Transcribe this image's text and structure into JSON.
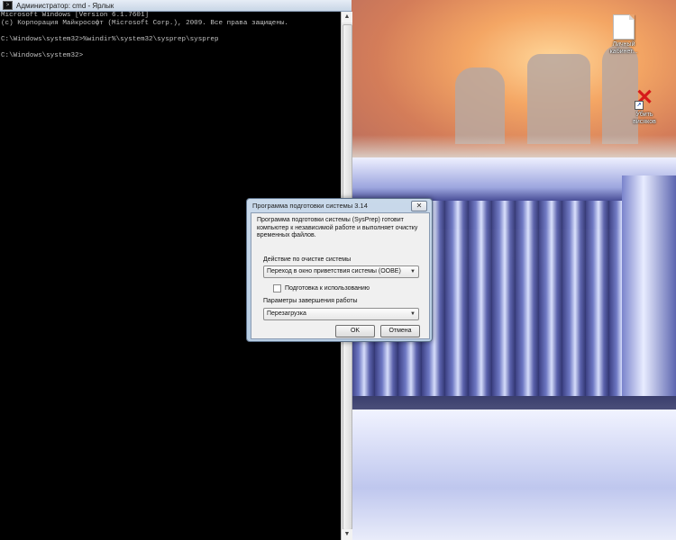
{
  "cmd": {
    "title": "Администратор: cmd - Ярлык",
    "lines": [
      "Microsoft Windows [Version 6.1.7601]",
      "(c) Корпорация Майкрософт (Microsoft Corp.), 2009. Все права защищены.",
      "",
      "C:\\Windows\\system32>%windir%\\system32\\sysprep\\sysprep",
      "",
      "C:\\Windows\\system32>"
    ]
  },
  "desktop": {
    "icons": [
      {
        "label_1": "Личный",
        "label_2": "кабинет...",
        "icon": "document-icon"
      },
      {
        "label_1": "Убить",
        "label_2": "висяков",
        "icon": "red-x-shortcut-icon"
      }
    ]
  },
  "dialog": {
    "title": "Программа подготовки системы 3.14",
    "close_label": "✕",
    "description": "Программа подготовки системы (SysPrep) готовит компьютер к независимой работе и выполняет очистку временных файлов.",
    "cleanup_label": "Действие по очистке системы",
    "cleanup_value": "Переход в окно приветствия системы (OOBE)",
    "generalize_label": "Подготовка к использованию",
    "generalize_checked": false,
    "shutdown_label": "Параметры завершения работы",
    "shutdown_value": "Перезагрузка",
    "ok_label": "OK",
    "cancel_label": "Отмена"
  },
  "colors": {
    "console_bg": "#000000",
    "console_text": "#c0c0c0",
    "dialog_frame": "#b7cde3"
  }
}
